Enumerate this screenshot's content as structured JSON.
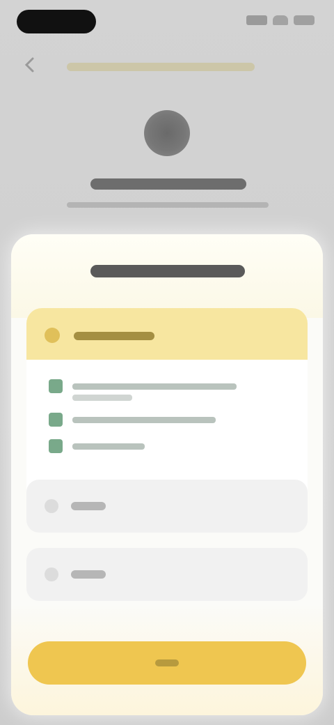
{
  "status_bar": {
    "icons": [
      "signal-icon",
      "wifi-icon",
      "battery-icon"
    ]
  },
  "nav": {
    "back_icon": "chevron-left-icon"
  },
  "colors": {
    "plan_highlight": "#f7e6a0",
    "accent": "#efc650",
    "check": "#79a98a"
  },
  "icons": {
    "plan_radio": "radio-selected-icon",
    "option_radio": "radio-unselected-icon",
    "feature_check": "check-icon"
  }
}
